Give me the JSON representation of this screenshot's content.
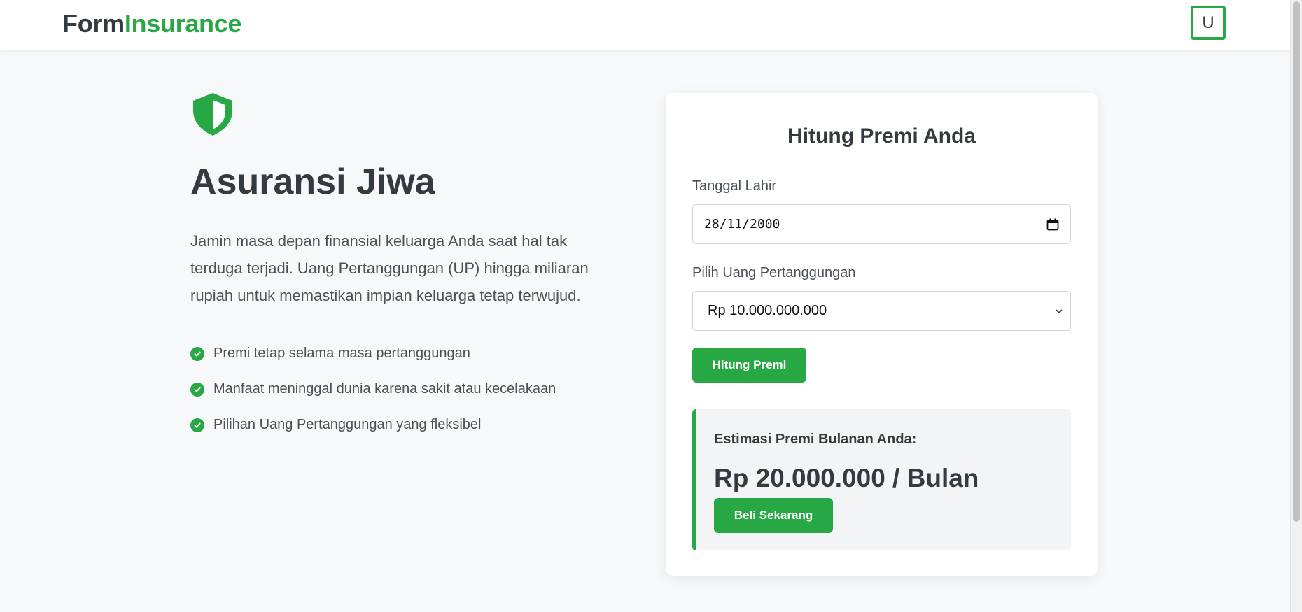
{
  "header": {
    "brand_part1": "Form",
    "brand_part2": "Insurance",
    "avatar_initial": "U"
  },
  "hero": {
    "icon": "shield-icon",
    "title": "Asuransi Jiwa",
    "description": "Jamin masa depan finansial keluarga Anda saat hal tak terduga terjadi. Uang Pertanggungan (UP) hingga miliaran rupiah untuk memastikan impian keluarga tetap terwujud.",
    "features": [
      "Premi tetap selama masa pertanggungan",
      "Manfaat meninggal dunia karena sakit atau kecelakaan",
      "Pilihan Uang Pertanggungan yang fleksibel"
    ]
  },
  "form": {
    "title": "Hitung Premi Anda",
    "birthdate_label": "Tanggal Lahir",
    "birthdate_value": "28/11/2000",
    "sum_assured_label": "Pilih Uang Pertanggungan",
    "sum_assured_value": "Rp 10.000.000.000",
    "calculate_button": "Hitung Premi"
  },
  "result": {
    "label": "Estimasi Premi Bulanan Anda:",
    "value": "Rp 20.000.000 / Bulan",
    "buy_button": "Beli Sekarang"
  },
  "colors": {
    "accent": "#28a745",
    "text": "#333a40",
    "background": "#f7f8fa"
  }
}
